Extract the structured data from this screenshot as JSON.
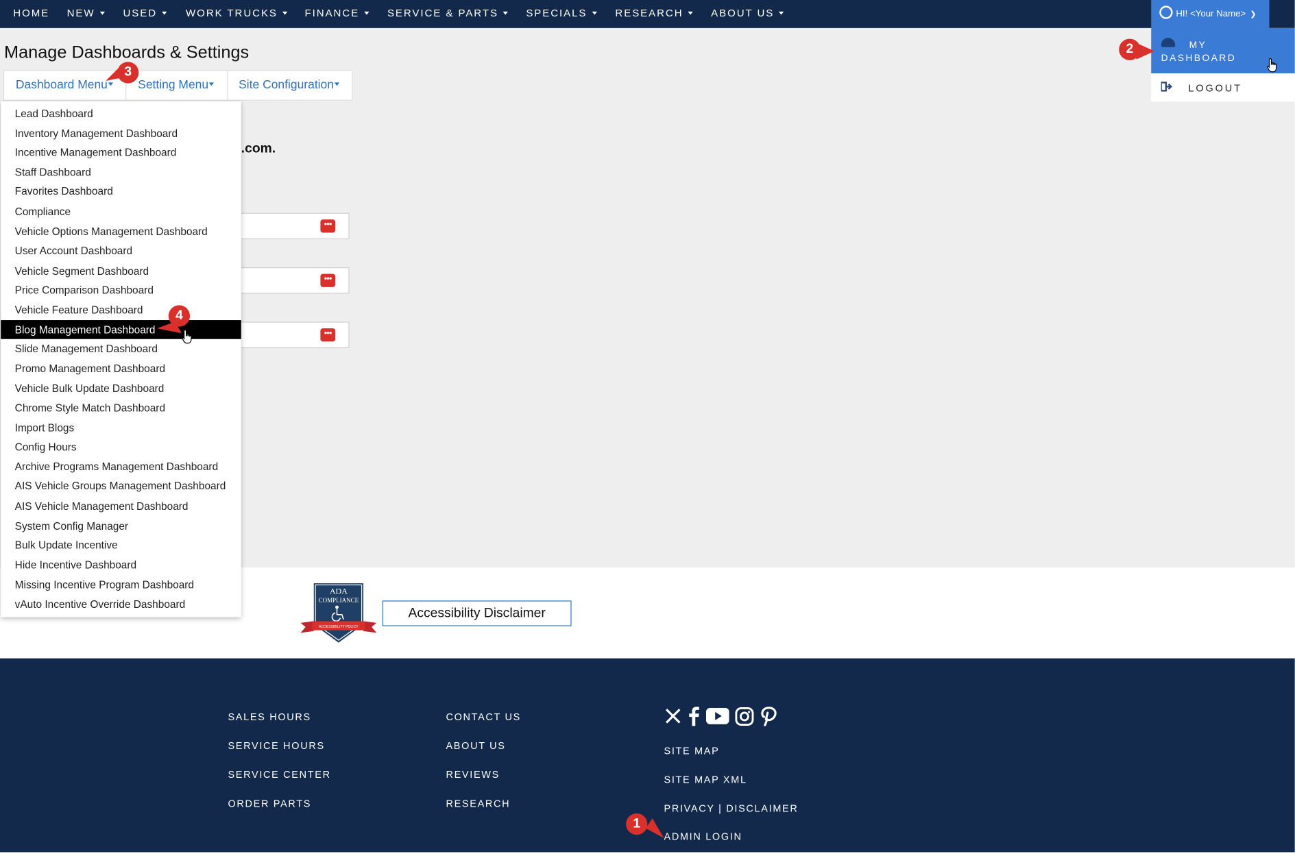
{
  "nav": {
    "items": [
      {
        "label": "HOME",
        "dropdown": false
      },
      {
        "label": "NEW",
        "dropdown": true
      },
      {
        "label": "USED",
        "dropdown": true
      },
      {
        "label": "WORK TRUCKS",
        "dropdown": true
      },
      {
        "label": "FINANCE",
        "dropdown": true
      },
      {
        "label": "SERVICE & PARTS",
        "dropdown": true
      },
      {
        "label": "SPECIALS",
        "dropdown": true
      },
      {
        "label": "RESEARCH",
        "dropdown": true
      },
      {
        "label": "ABOUT US",
        "dropdown": true
      }
    ]
  },
  "user_menu": {
    "greeting": "HI! <Your Name>",
    "my_dashboard": "MY DASHBOARD",
    "logout": "LOGOUT"
  },
  "page": {
    "title": "Manage Dashboards & Settings",
    "tabs": [
      {
        "label": "Dashboard Menu"
      },
      {
        "label": "Setting Menu"
      },
      {
        "label": "Site Configuration"
      }
    ],
    "background_text": ".com."
  },
  "dashboard_menu": {
    "items": [
      "Lead Dashboard",
      "Inventory Management Dashboard",
      "Incentive Management Dashboard",
      "Staff Dashboard",
      "Favorites Dashboard",
      "Compliance",
      "Vehicle Options Management Dashboard",
      "User Account Dashboard",
      "Vehicle Segment Dashboard",
      "Price Comparison Dashboard",
      "Vehicle Feature Dashboard",
      "Blog Management Dashboard",
      "Slide Management Dashboard",
      "Promo Management Dashboard",
      "Vehicle Bulk Update Dashboard",
      "Chrome Style Match Dashboard",
      "Import Blogs",
      "Config Hours",
      "Archive Programs Management Dashboard",
      "AIS Vehicle Groups Management Dashboard",
      "AIS Vehicle Management Dashboard",
      "System Config Manager",
      "Bulk Update Incentive",
      "Hide Incentive Dashboard",
      "Missing Incentive Program Dashboard",
      "vAuto Incentive Override Dashboard"
    ],
    "active_item": "Blog Management Dashboard"
  },
  "ada": {
    "badge_line1": "ADA",
    "badge_line2": "COMPLIANCE",
    "badge_ribbon": "ACCESSIBILITY POLICY",
    "disclaimer_button": "Accessibility Disclaimer"
  },
  "footer": {
    "col1": [
      "SALES HOURS",
      "SERVICE HOURS",
      "SERVICE CENTER",
      "ORDER PARTS"
    ],
    "col2": [
      "CONTACT US",
      "ABOUT US",
      "REVIEWS",
      "RESEARCH"
    ],
    "col3": [
      "SITE MAP",
      "SITE MAP XML",
      "PRIVACY | DISCLAIMER",
      "ADMIN LOGIN"
    ],
    "social_icons": [
      "x-icon",
      "facebook-icon",
      "youtube-icon",
      "instagram-icon",
      "pinterest-icon"
    ]
  },
  "callouts": [
    "1",
    "2",
    "3",
    "4"
  ],
  "colors": {
    "nav_bg": "#13294b",
    "accent_blue": "#3a7bd5",
    "link_blue": "#2a72c4",
    "callout_red": "#d9302c",
    "content_bg": "#eeeeee"
  }
}
